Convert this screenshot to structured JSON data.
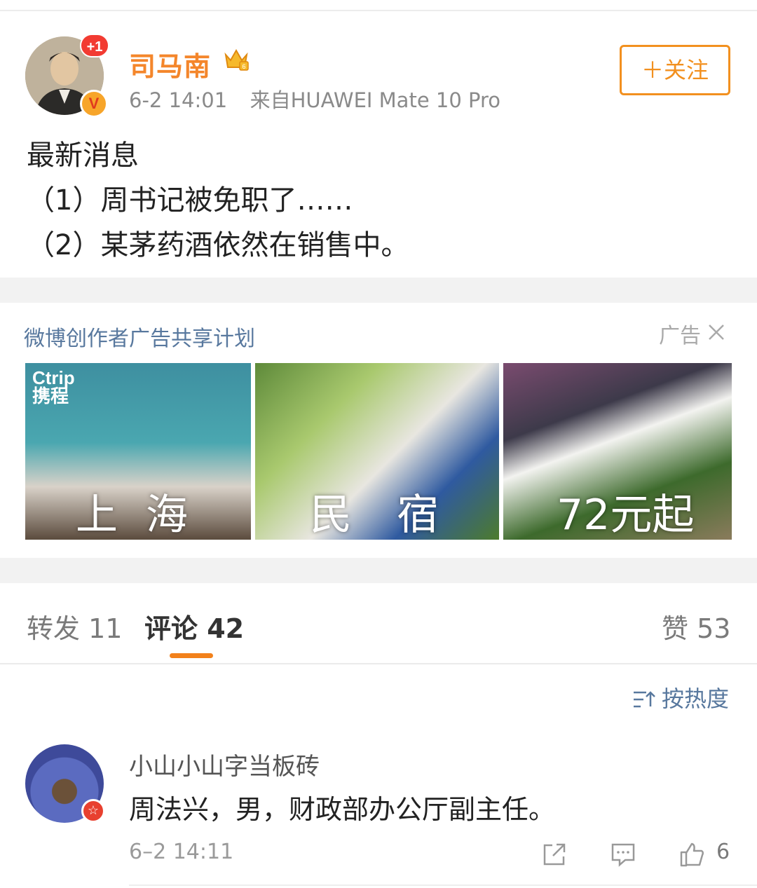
{
  "post": {
    "username": "司马南",
    "plus_badge": "+1",
    "verified_badge": "V",
    "time": "6-2 14:01",
    "source": "来自HUAWEI Mate 10 Pro",
    "follow_label": "＋关注",
    "content_lines": [
      "最新消息",
      "（1）周书记被免职了……",
      "（2）某茅药酒依然在销售中。"
    ]
  },
  "ad": {
    "label": "微博创作者广告共享计划",
    "tag": "广告",
    "logo_en": "Ctrip",
    "logo_cn": "携程",
    "banner_texts": [
      "上",
      "海",
      "民",
      "宿",
      "72元起"
    ]
  },
  "tabs": {
    "repost": "转发 11",
    "comments": "评论 42",
    "likes": "赞 53"
  },
  "sort_label": "按热度",
  "comment": {
    "name": "小山小山字当板砖",
    "text": "周法兴，男，财政部办公厅副主任。",
    "time": "6–2 14:11",
    "likes": "6"
  },
  "colors": {
    "username": "#f4862b",
    "accent": "#f2811b",
    "link_blue": "#58789e"
  }
}
